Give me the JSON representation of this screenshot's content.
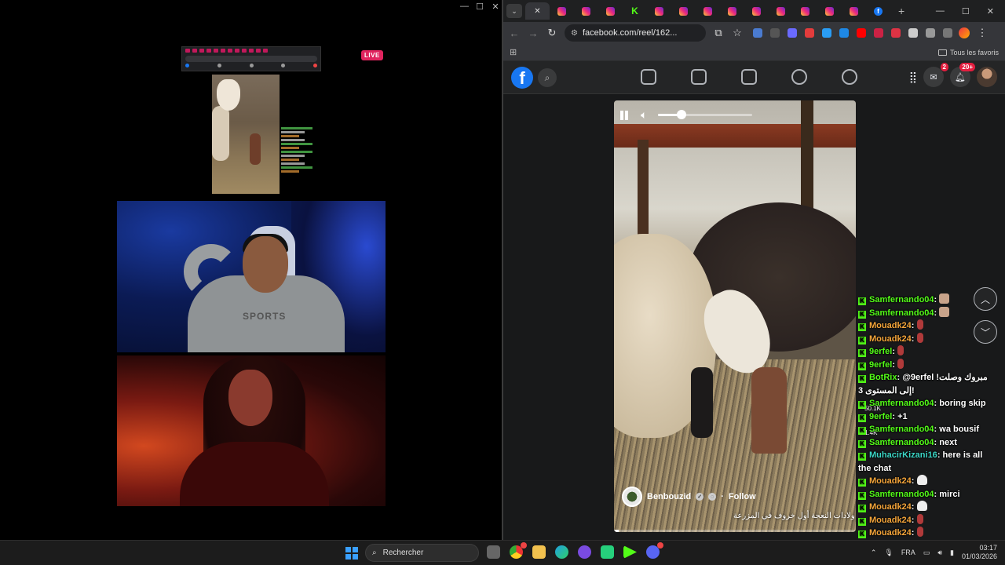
{
  "left": {
    "live_label": "LIVE",
    "hoodie_text": "SPORTS"
  },
  "browser": {
    "tabs": [
      {
        "icon": "close",
        "active": true
      },
      {
        "icon": "instagram"
      },
      {
        "icon": "instagram"
      },
      {
        "icon": "instagram"
      },
      {
        "icon": "kick"
      },
      {
        "icon": "instagram"
      },
      {
        "icon": "instagram"
      },
      {
        "icon": "instagram"
      },
      {
        "icon": "instagram"
      },
      {
        "icon": "instagram"
      },
      {
        "icon": "instagram"
      },
      {
        "icon": "instagram"
      },
      {
        "icon": "instagram"
      },
      {
        "icon": "instagram"
      },
      {
        "icon": "facebook"
      }
    ],
    "url": "facebook.com/reel/162...",
    "bookmarks_all": "Tous les favoris",
    "extension_colors": [
      "#4a7bd0",
      "#555555",
      "#6a6aff",
      "#e33c3c",
      "#2a9df4",
      "#1e88e5",
      "#ff0000",
      "#cc2244",
      "#dd3344",
      "#cccccc",
      "#999999",
      "#777777"
    ]
  },
  "facebook": {
    "messenger_badge": "2",
    "notifications_badge": "20+"
  },
  "reel": {
    "author": "Benbouzid",
    "follow": "Follow",
    "caption": "ولادات النعجة أول خروف في المزرعة",
    "volume_fraction": 0.25,
    "progress_fraction": 0.02,
    "side_count_1": "50.1K",
    "side_count_2": "1.4K"
  },
  "chat": [
    {
      "user": "Samfernando04",
      "color": "green",
      "msg": "",
      "emote": "face"
    },
    {
      "user": "Samfernando04",
      "color": "green",
      "msg": "",
      "emote": "face"
    },
    {
      "user": "Mouadk24",
      "color": "orange",
      "msg": "",
      "emote": "red"
    },
    {
      "user": "Mouadk24",
      "color": "orange",
      "msg": "",
      "emote": "red"
    },
    {
      "user": "9erfel",
      "color": "green",
      "msg": "",
      "emote": "red"
    },
    {
      "user": "9erfel",
      "color": "green",
      "msg": "",
      "emote": "red"
    },
    {
      "user": "BotRix",
      "color": "green",
      "msg": "@9erfel !مبروك وصلت إلى المستوى 3!",
      "emote": ""
    },
    {
      "user": "Samfernando04",
      "color": "green",
      "msg": "boring skip",
      "emote": ""
    },
    {
      "user": "9erfel",
      "color": "green",
      "msg": "+1",
      "emote": ""
    },
    {
      "user": "Samfernando04",
      "color": "green",
      "msg": "wa bousif",
      "emote": ""
    },
    {
      "user": "Samfernando04",
      "color": "green",
      "msg": "next",
      "emote": ""
    },
    {
      "user": "MuhacirKizani16",
      "color": "blue",
      "msg": "here is all the chat",
      "emote": ""
    },
    {
      "user": "Mouadk24",
      "color": "orange",
      "msg": "",
      "emote": "ghost"
    },
    {
      "user": "Samfernando04",
      "color": "green",
      "msg": "mirci",
      "emote": ""
    },
    {
      "user": "Mouadk24",
      "color": "orange",
      "msg": "",
      "emote": "ghost"
    },
    {
      "user": "Mouadk24",
      "color": "orange",
      "msg": "",
      "emote": "red"
    },
    {
      "user": "Mouadk24",
      "color": "orange",
      "msg": "",
      "emote": "red"
    }
  ],
  "taskbar": {
    "search_placeholder": "Rechercher",
    "lang": "FRA",
    "time": "03:17",
    "date": "01/03/2026"
  }
}
